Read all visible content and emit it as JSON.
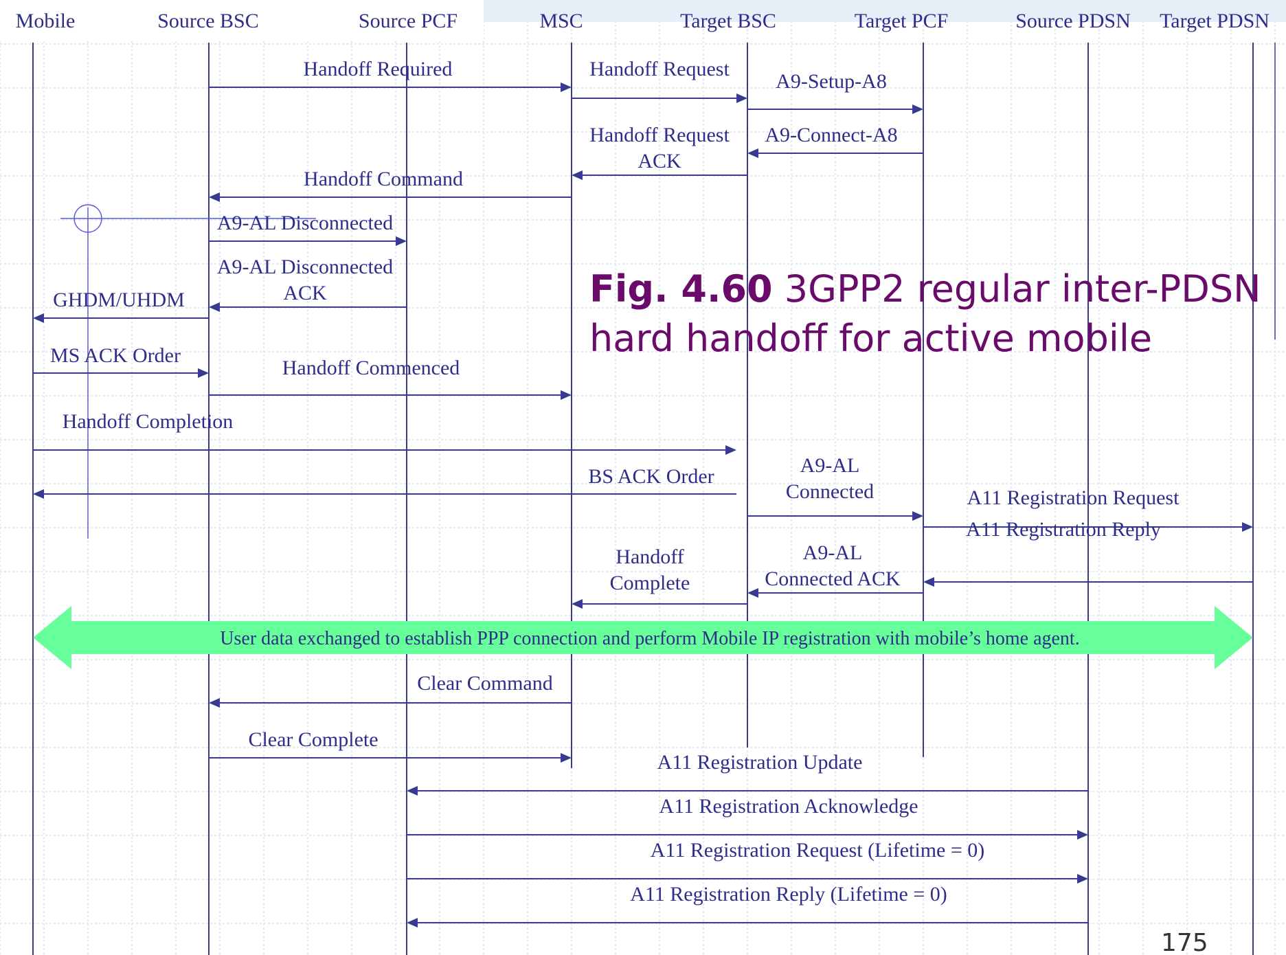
{
  "participants": [
    {
      "id": "mobile",
      "label": "Mobile"
    },
    {
      "id": "source_bsc",
      "label": "Source BSC"
    },
    {
      "id": "source_pcf",
      "label": "Source PCF"
    },
    {
      "id": "msc",
      "label": "MSC"
    },
    {
      "id": "target_bsc",
      "label": "Target BSC"
    },
    {
      "id": "target_pcf",
      "label": "Target PCF"
    },
    {
      "id": "source_pdsn",
      "label": "Source PDSN"
    },
    {
      "id": "target_pdsn",
      "label": "Target PDSN"
    }
  ],
  "messages": [
    {
      "from": "source_bsc",
      "to": "msc",
      "label": [
        "Handoff Required"
      ]
    },
    {
      "from": "msc",
      "to": "target_bsc",
      "label": [
        "Handoff Request"
      ]
    },
    {
      "from": "target_bsc",
      "to": "target_pcf",
      "label": [
        "A9-Setup-A8"
      ]
    },
    {
      "from": "target_pcf",
      "to": "target_bsc",
      "label": [
        "A9-Connect-A8"
      ]
    },
    {
      "from": "target_bsc",
      "to": "msc",
      "label": [
        "Handoff Request",
        "ACK"
      ]
    },
    {
      "from": "msc",
      "to": "source_bsc",
      "label": [
        "Handoff Command"
      ]
    },
    {
      "from": "source_bsc",
      "to": "source_pcf",
      "label": [
        "A9-AL Disconnected"
      ]
    },
    {
      "from": "source_pcf",
      "to": "source_bsc",
      "label": [
        "A9-AL Disconnected",
        "ACK"
      ]
    },
    {
      "from": "source_bsc",
      "to": "mobile",
      "label": [
        "GHDM/UHDM"
      ]
    },
    {
      "from": "mobile",
      "to": "source_bsc",
      "label": [
        "MS ACK Order"
      ]
    },
    {
      "from": "source_bsc",
      "to": "msc",
      "label": [
        "Handoff Commenced"
      ]
    },
    {
      "from": "mobile",
      "to": "target_bsc",
      "label": [
        "Handoff Completion"
      ]
    },
    {
      "from": "target_bsc",
      "to": "mobile",
      "label": [
        "BS ACK Order"
      ]
    },
    {
      "from": "target_bsc",
      "to": "target_pcf",
      "label": [
        "A9-AL",
        "Connected"
      ]
    },
    {
      "from": "target_pcf",
      "to": "target_pdsn",
      "label": [
        "A11 Registration Request"
      ]
    },
    {
      "from": "target_pdsn",
      "to": "target_pcf",
      "label": [
        "A11 Registration Reply"
      ]
    },
    {
      "from": "target_pcf",
      "to": "target_bsc",
      "label": [
        "A9-AL",
        "Connected ACK"
      ]
    },
    {
      "from": "target_bsc",
      "to": "msc",
      "label": [
        "Handoff",
        "Complete"
      ]
    },
    {
      "from": "msc",
      "to": "source_bsc",
      "label": [
        "Clear Command"
      ]
    },
    {
      "from": "source_bsc",
      "to": "msc",
      "label": [
        "Clear Complete"
      ]
    },
    {
      "from": "source_pdsn",
      "to": "source_pcf",
      "label": [
        "A11 Registration Update"
      ]
    },
    {
      "from": "source_pcf",
      "to": "source_pdsn",
      "label": [
        "A11 Registration Acknowledge"
      ]
    },
    {
      "from": "source_pcf",
      "to": "source_pdsn",
      "label": [
        "A11 Registration Request (Lifetime = 0)"
      ]
    },
    {
      "from": "source_pdsn",
      "to": "source_pcf",
      "label": [
        "A11 Registration Reply (Lifetime = 0)"
      ]
    }
  ],
  "data_exchange": {
    "label": "User data exchanged to establish PPP connection and perform Mobile IP registration with mobile’s home agent."
  },
  "caption": {
    "figure": "Fig. 4.60",
    "text": "3GPP2 regular inter-PDSN hard handoff for active mobile"
  },
  "page_number": "175",
  "colors": {
    "line": "#3a3a8c",
    "text": "#2e2e8a",
    "arrow_band": "#66ff99",
    "caption": "#6a0a6a",
    "grid": "#c8d3ec"
  }
}
